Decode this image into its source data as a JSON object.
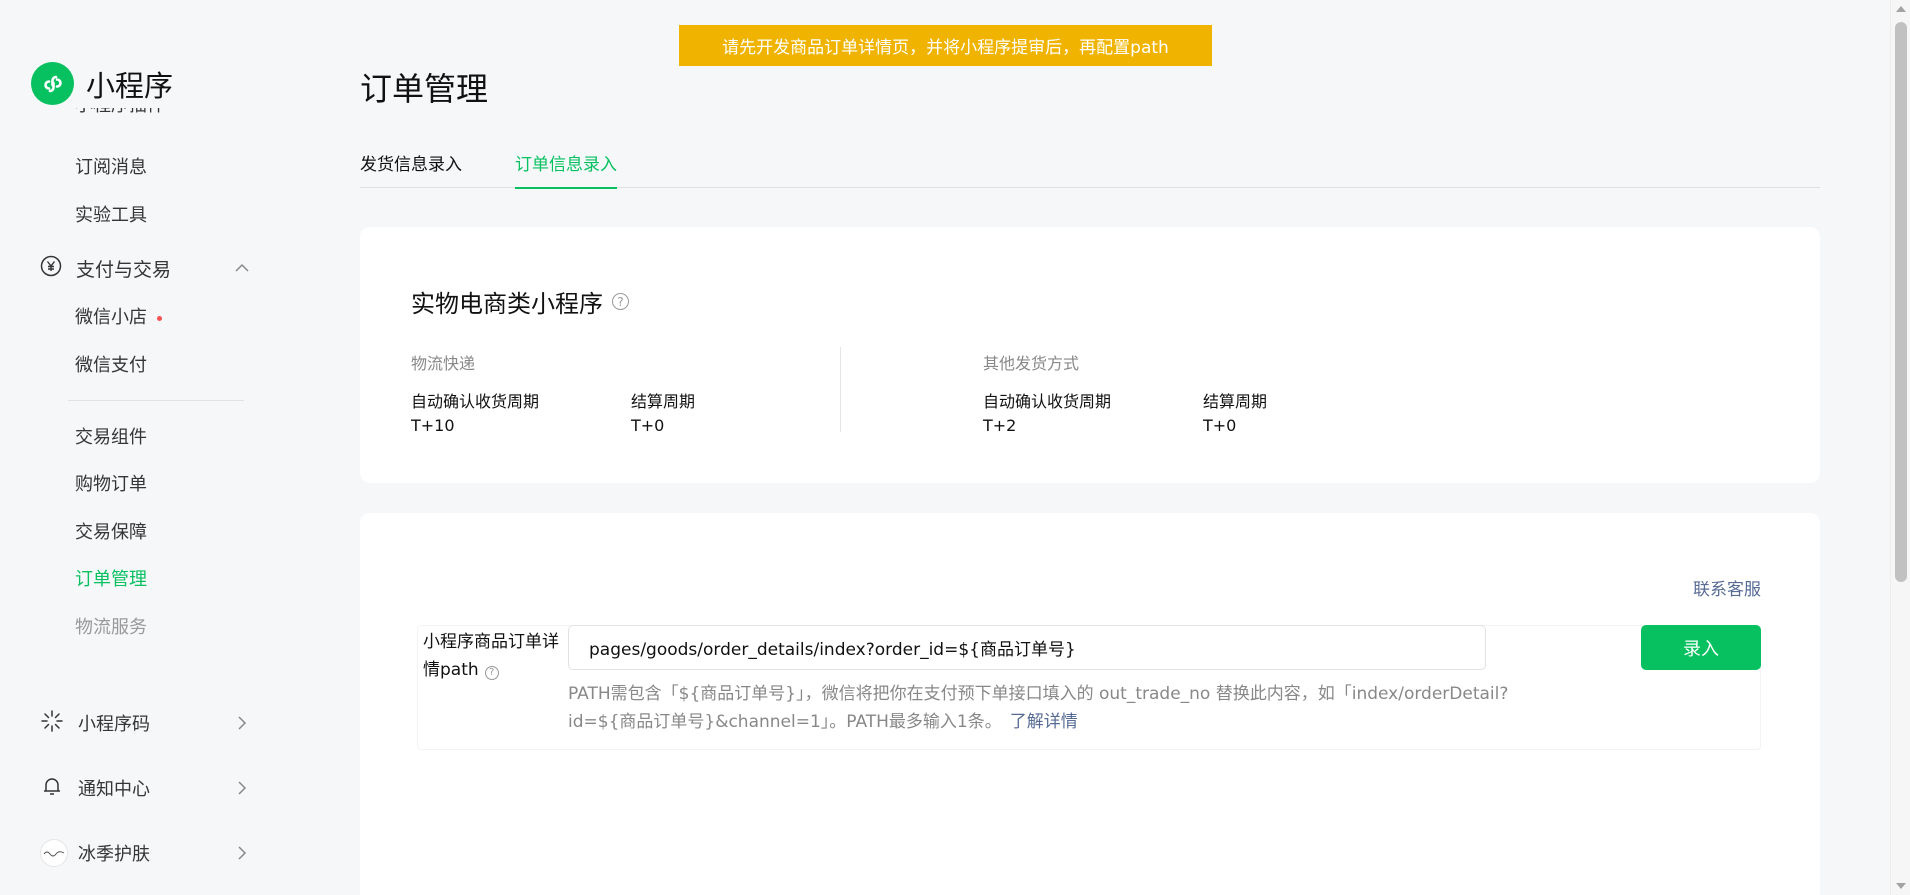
{
  "brand": {
    "name": "小程序",
    "logo_icon": "miniprogram-logo-icon"
  },
  "sidebar": {
    "partial_item": "小程序插件",
    "items_top": [
      "订阅消息",
      "实验工具"
    ],
    "pay_group": {
      "label": "支付与交易",
      "icon": "yuan-circle-icon",
      "expanded": true
    },
    "pay_items": [
      {
        "label": "微信小店",
        "has_dot": true
      },
      {
        "label": "微信支付"
      }
    ],
    "trade_items": [
      {
        "label": "交易组件"
      },
      {
        "label": "购物订单"
      },
      {
        "label": "交易保障"
      },
      {
        "label": "订单管理",
        "active": true
      },
      {
        "label": "物流服务"
      }
    ],
    "bottom": [
      {
        "label": "小程序码",
        "icon": "qrcode-icon"
      },
      {
        "label": "通知中心",
        "icon": "bell-icon"
      },
      {
        "label": "冰季护肤",
        "icon": "avatar"
      }
    ]
  },
  "notice": {
    "text": "请先开发商品订单详情页，并将小程序提审后，再配置path"
  },
  "page": {
    "title": "订单管理"
  },
  "tabs": [
    {
      "label": "发货信息录入",
      "active": false
    },
    {
      "label": "订单信息录入",
      "active": true
    }
  ],
  "shipping_card": {
    "title": "实物电商类小程序",
    "columns": [
      {
        "header": "物流快递",
        "fields": [
          {
            "label": "自动确认收货周期",
            "value": "T+10"
          },
          {
            "label": "结算周期",
            "value": "T+0"
          }
        ]
      },
      {
        "header": "其他发货方式",
        "fields": [
          {
            "label": "自动确认收货周期",
            "value": "T+2"
          },
          {
            "label": "结算周期",
            "value": "T+0"
          }
        ]
      }
    ]
  },
  "path_card": {
    "contact_label": "联系客服",
    "field_label": "小程序商品订单详情path",
    "input_value": "pages/goods/order_details/index?order_id=${商品订单号}",
    "submit_label": "录入",
    "help_text": "PATH需包含「${商品订单号}」，微信将把你在支付预下单接口填入的 out_trade_no 替换此内容，如「index/orderDetail?id=${商品订单号}&channel=1」。PATH最多输入1条。",
    "learn_more": "了解详情"
  },
  "colors": {
    "accent": "#07c160",
    "notice": "#f0b400",
    "link": "#576b95",
    "dot": "#fa5151"
  }
}
